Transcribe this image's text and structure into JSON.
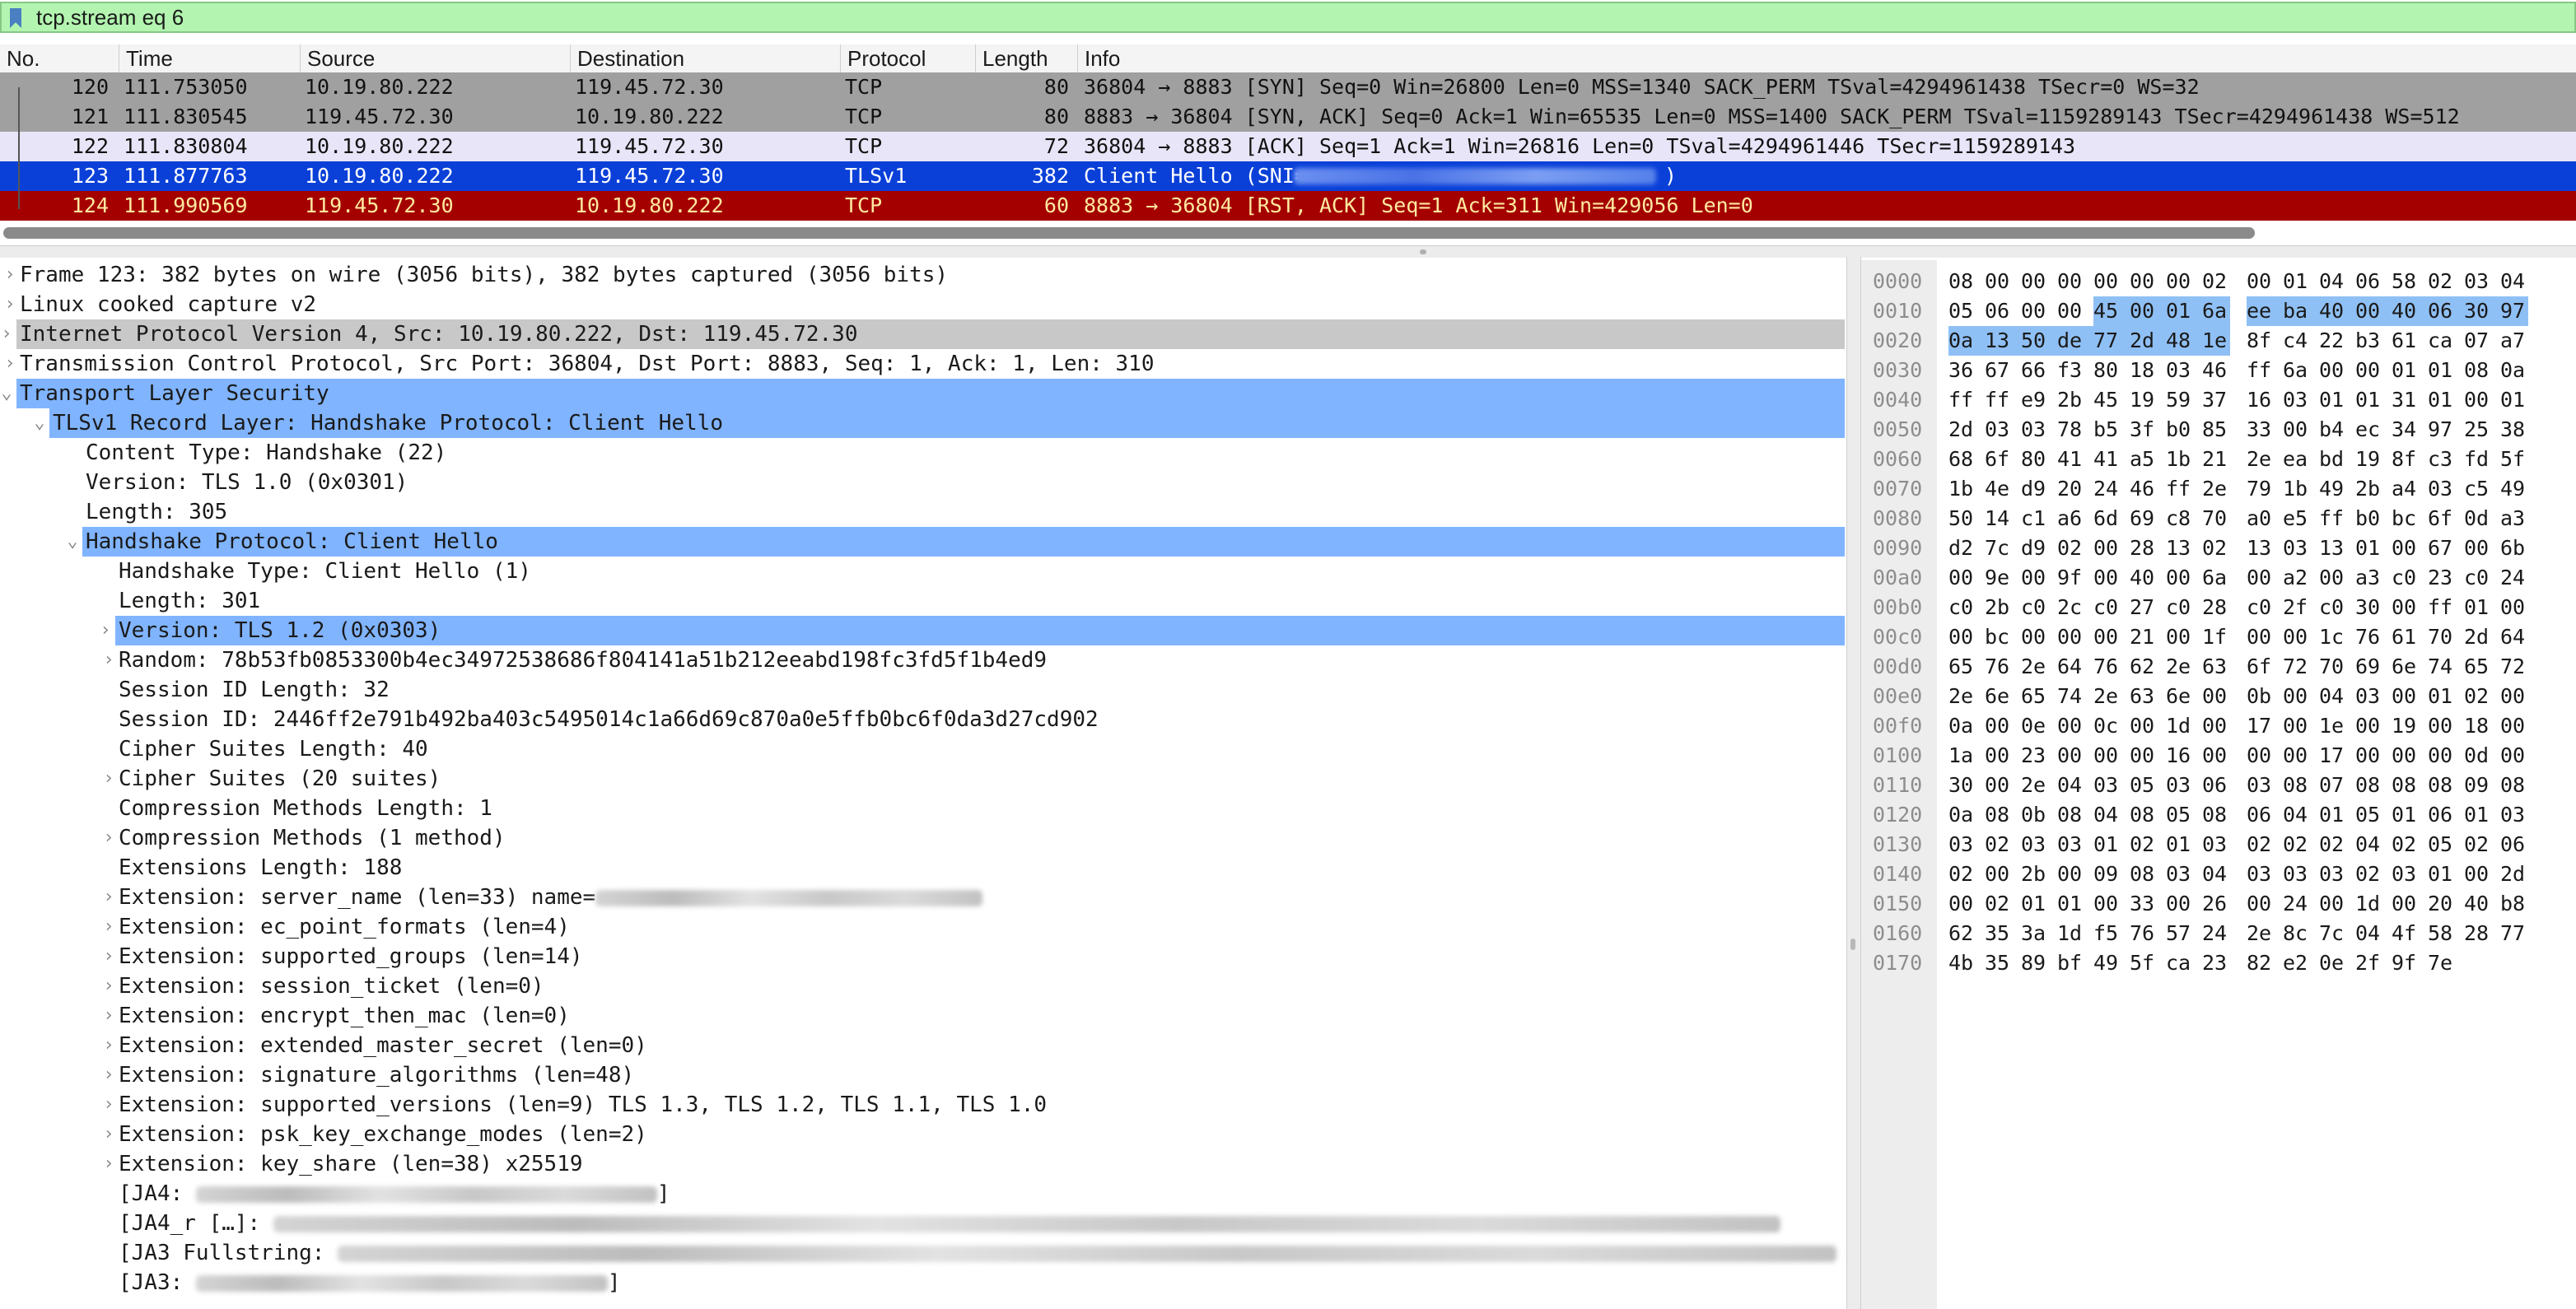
{
  "filter": {
    "value": "tcp.stream eq 6"
  },
  "columns": [
    "No.",
    "Time",
    "Source",
    "Destination",
    "Protocol",
    "Length",
    "Info"
  ],
  "packets": [
    {
      "no": "120",
      "time": "111.753050",
      "src": "10.19.80.222",
      "dst": "119.45.72.30",
      "proto": "TCP",
      "len": "80",
      "info": "36804 → 8883 [SYN] Seq=0 Win=26800 Len=0 MSS=1340 SACK_PERM TSval=4294961438 TSecr=0 WS=32",
      "style": "gray"
    },
    {
      "no": "121",
      "time": "111.830545",
      "src": "119.45.72.30",
      "dst": "10.19.80.222",
      "proto": "TCP",
      "len": "80",
      "info": "8883 → 36804 [SYN, ACK] Seq=0 Ack=1 Win=65535 Len=0 MSS=1400 SACK_PERM TSval=1159289143 TSecr=4294961438 WS=512",
      "style": "gray"
    },
    {
      "no": "122",
      "time": "111.830804",
      "src": "10.19.80.222",
      "dst": "119.45.72.30",
      "proto": "TCP",
      "len": "72",
      "info": "36804 → 8883 [ACK] Seq=1 Ack=1 Win=26816 Len=0 TSval=4294961446 TSecr=1159289143",
      "style": "lav"
    },
    {
      "no": "123",
      "time": "111.877763",
      "src": "10.19.80.222",
      "dst": "119.45.72.30",
      "proto": "TLSv1",
      "len": "382",
      "info": "Client Hello (SNI=",
      "info_end": ")",
      "style": "blue"
    },
    {
      "no": "124",
      "time": "111.990569",
      "src": "119.45.72.30",
      "dst": "10.19.80.222",
      "proto": "TCP",
      "len": "60",
      "info": "8883 → 36804 [RST, ACK] Seq=1 Ack=311 Win=429056 Len=0",
      "style": "red"
    }
  ],
  "details": [
    {
      "indent": 0,
      "arrow": "›",
      "text": "Frame 123: 382 bytes on wire (3056 bits), 382 bytes captured (3056 bits)"
    },
    {
      "indent": 0,
      "arrow": "›",
      "text": "Linux cooked capture v2"
    },
    {
      "indent": 0,
      "arrow": "›",
      "text": "Internet Protocol Version 4, Src: 10.19.80.222, Dst: 119.45.72.30",
      "hl": "gray"
    },
    {
      "indent": 0,
      "arrow": "›",
      "text": "Transmission Control Protocol, Src Port: 36804, Dst Port: 8883, Seq: 1, Ack: 1, Len: 310"
    },
    {
      "indent": 0,
      "arrow": "⌄",
      "text": "Transport Layer Security",
      "hl": "blue"
    },
    {
      "indent": 1,
      "arrow": "⌄",
      "text": "TLSv1 Record Layer: Handshake Protocol: Client Hello",
      "hl": "blue"
    },
    {
      "indent": 2,
      "arrow": "",
      "text": "Content Type: Handshake (22)"
    },
    {
      "indent": 2,
      "arrow": "",
      "text": "Version: TLS 1.0 (0x0301)"
    },
    {
      "indent": 2,
      "arrow": "",
      "text": "Length: 305"
    },
    {
      "indent": 2,
      "arrow": "⌄",
      "text": "Handshake Protocol: Client Hello",
      "hl": "blue"
    },
    {
      "indent": 3,
      "arrow": "",
      "text": "Handshake Type: Client Hello (1)"
    },
    {
      "indent": 3,
      "arrow": "",
      "text": "Length: 301"
    },
    {
      "indent": 3,
      "arrow": "›",
      "text": "Version: TLS 1.2 (0x0303)",
      "hl": "blue"
    },
    {
      "indent": 3,
      "arrow": "›",
      "text": "Random: 78b53fb0853300b4ec34972538686f804141a51b212eeabd198fc3fd5f1b4ed9"
    },
    {
      "indent": 3,
      "arrow": "",
      "text": "Session ID Length: 32"
    },
    {
      "indent": 3,
      "arrow": "",
      "text": "Session ID: 2446ff2e791b492ba403c5495014c1a66d69c870a0e5ffb0bc6f0da3d27cd902"
    },
    {
      "indent": 3,
      "arrow": "",
      "text": "Cipher Suites Length: 40"
    },
    {
      "indent": 3,
      "arrow": "›",
      "text": "Cipher Suites (20 suites)"
    },
    {
      "indent": 3,
      "arrow": "",
      "text": "Compression Methods Length: 1"
    },
    {
      "indent": 3,
      "arrow": "›",
      "text": "Compression Methods (1 method)"
    },
    {
      "indent": 3,
      "arrow": "",
      "text": "Extensions Length: 188"
    },
    {
      "indent": 3,
      "arrow": "›",
      "text": "Extension: server_name (len=33) name=",
      "blur": 470
    },
    {
      "indent": 3,
      "arrow": "›",
      "text": "Extension: ec_point_formats (len=4)"
    },
    {
      "indent": 3,
      "arrow": "›",
      "text": "Extension: supported_groups (len=14)"
    },
    {
      "indent": 3,
      "arrow": "›",
      "text": "Extension: session_ticket (len=0)"
    },
    {
      "indent": 3,
      "arrow": "›",
      "text": "Extension: encrypt_then_mac (len=0)"
    },
    {
      "indent": 3,
      "arrow": "›",
      "text": "Extension: extended_master_secret (len=0)"
    },
    {
      "indent": 3,
      "arrow": "›",
      "text": "Extension: signature_algorithms (len=48)"
    },
    {
      "indent": 3,
      "arrow": "›",
      "text": "Extension: supported_versions (len=9) TLS 1.3, TLS 1.2, TLS 1.1, TLS 1.0"
    },
    {
      "indent": 3,
      "arrow": "›",
      "text": "Extension: psk_key_exchange_modes (len=2)"
    },
    {
      "indent": 3,
      "arrow": "›",
      "text": "Extension: key_share (len=38) x25519"
    },
    {
      "indent": 3,
      "arrow": "",
      "text": "[JA4: ",
      "blur": 560,
      "tail": "]"
    },
    {
      "indent": 3,
      "arrow": "",
      "text": "[JA4_r […]: ",
      "blur": 1830
    },
    {
      "indent": 3,
      "arrow": "",
      "text": "[JA3 Fullstring: ",
      "blur": 1820
    },
    {
      "indent": 3,
      "arrow": "",
      "text": "[JA3: ",
      "blur": 500,
      "tail": "]"
    }
  ],
  "hex": [
    {
      "off": "0000",
      "bytes": "08 00 00 00 00 00 00 02 00 01 04 06 58 02 03 04",
      "sel": []
    },
    {
      "off": "0010",
      "bytes": "05 06 00 00 45 00 01 6a ee ba 40 00 40 06 30 97",
      "sel": [
        4,
        5,
        6,
        7,
        8,
        9,
        10,
        11,
        12,
        13,
        14,
        15
      ]
    },
    {
      "off": "0020",
      "bytes": "0a 13 50 de 77 2d 48 1e 8f c4 22 b3 61 ca 07 a7",
      "sel": [
        0,
        1,
        2,
        3,
        4,
        5,
        6,
        7
      ]
    },
    {
      "off": "0030",
      "bytes": "36 67 66 f3 80 18 03 46 ff 6a 00 00 01 01 08 0a",
      "sel": []
    },
    {
      "off": "0040",
      "bytes": "ff ff e9 2b 45 19 59 37 16 03 01 01 31 01 00 01",
      "sel": []
    },
    {
      "off": "0050",
      "bytes": "2d 03 03 78 b5 3f b0 85 33 00 b4 ec 34 97 25 38",
      "sel": []
    },
    {
      "off": "0060",
      "bytes": "68 6f 80 41 41 a5 1b 21 2e ea bd 19 8f c3 fd 5f",
      "sel": []
    },
    {
      "off": "0070",
      "bytes": "1b 4e d9 20 24 46 ff 2e 79 1b 49 2b a4 03 c5 49",
      "sel": []
    },
    {
      "off": "0080",
      "bytes": "50 14 c1 a6 6d 69 c8 70 a0 e5 ff b0 bc 6f 0d a3",
      "sel": []
    },
    {
      "off": "0090",
      "bytes": "d2 7c d9 02 00 28 13 02 13 03 13 01 00 67 00 6b",
      "sel": []
    },
    {
      "off": "00a0",
      "bytes": "00 9e 00 9f 00 40 00 6a 00 a2 00 a3 c0 23 c0 24",
      "sel": []
    },
    {
      "off": "00b0",
      "bytes": "c0 2b c0 2c c0 27 c0 28 c0 2f c0 30 00 ff 01 00",
      "sel": []
    },
    {
      "off": "00c0",
      "bytes": "00 bc 00 00 00 21 00 1f 00 00 1c 76 61 70 2d 64",
      "sel": []
    },
    {
      "off": "00d0",
      "bytes": "65 76 2e 64 76 62 2e 63 6f 72 70 69 6e 74 65 72",
      "sel": []
    },
    {
      "off": "00e0",
      "bytes": "2e 6e 65 74 2e 63 6e 00 0b 00 04 03 00 01 02 00",
      "sel": []
    },
    {
      "off": "00f0",
      "bytes": "0a 00 0e 00 0c 00 1d 00 17 00 1e 00 19 00 18 00",
      "sel": []
    },
    {
      "off": "0100",
      "bytes": "1a 00 23 00 00 00 16 00 00 00 17 00 00 00 0d 00",
      "sel": []
    },
    {
      "off": "0110",
      "bytes": "30 00 2e 04 03 05 03 06 03 08 07 08 08 08 09 08",
      "sel": []
    },
    {
      "off": "0120",
      "bytes": "0a 08 0b 08 04 08 05 08 06 04 01 05 01 06 01 03",
      "sel": []
    },
    {
      "off": "0130",
      "bytes": "03 02 03 03 01 02 01 03 02 02 02 04 02 05 02 06",
      "sel": []
    },
    {
      "off": "0140",
      "bytes": "02 00 2b 00 09 08 03 04 03 03 03 02 03 01 00 2d",
      "sel": []
    },
    {
      "off": "0150",
      "bytes": "00 02 01 01 00 33 00 26 00 24 00 1d 00 20 40 b8",
      "sel": []
    },
    {
      "off": "0160",
      "bytes": "62 35 3a 1d f5 76 57 24 2e 8c 7c 04 4f 58 28 77",
      "sel": []
    },
    {
      "off": "0170",
      "bytes": "4b 35 89 bf 49 5f ca 23 82 e2 0e 2f 9f 7e",
      "sel": []
    }
  ]
}
